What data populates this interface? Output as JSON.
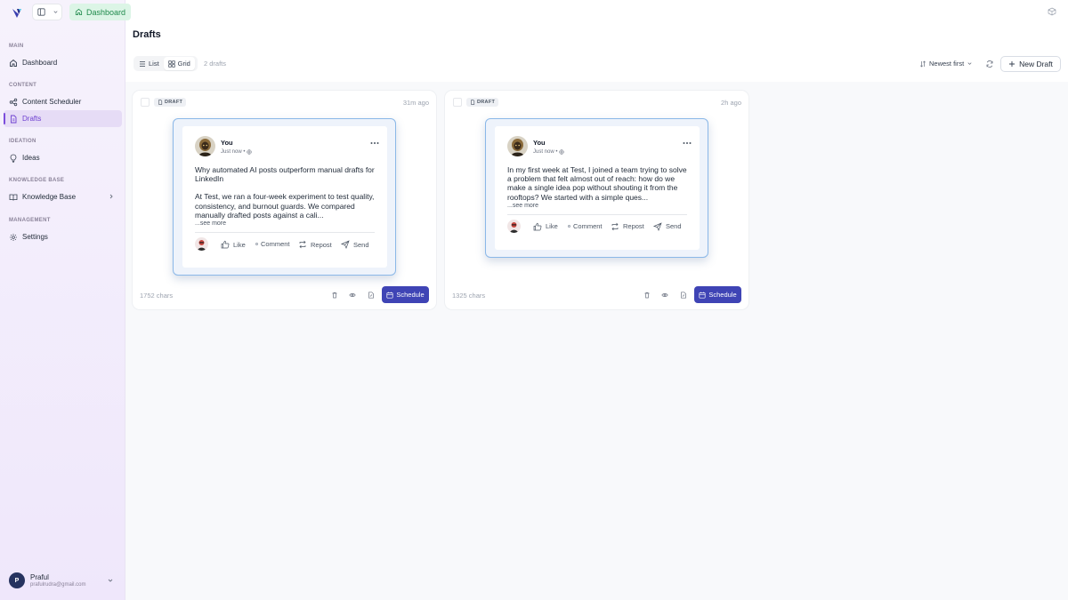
{
  "topbar": {
    "breadcrumb": "Dashboard"
  },
  "sidebar": {
    "sections": [
      {
        "label": "MAIN"
      },
      {
        "label": "CONTENT"
      },
      {
        "label": "IDEATION"
      },
      {
        "label": "KNOWLEDGE BASE"
      },
      {
        "label": "MANAGEMENT"
      }
    ],
    "items": [
      {
        "label": "Dashboard",
        "icon": "home-icon"
      },
      {
        "label": "Content Scheduler",
        "icon": "share-icon"
      },
      {
        "label": "Drafts",
        "icon": "document-icon",
        "active": true
      },
      {
        "label": "Ideas",
        "icon": "lightbulb-icon"
      },
      {
        "label": "Knowledge Base",
        "icon": "book-icon"
      },
      {
        "label": "Settings",
        "icon": "gear-icon"
      }
    ],
    "user": {
      "initial": "P",
      "name": "Praful",
      "email": "prafulrudra@gmail.com"
    }
  },
  "main": {
    "title": "Drafts",
    "view_toggle": {
      "list_label": "List",
      "grid_label": "Grid",
      "selected": "Grid"
    },
    "draft_count": "2 drafts",
    "sort_label": "Newest first",
    "new_draft_label": "New Draft"
  },
  "cards": [
    {
      "badge": "DRAFT",
      "time": "31m ago",
      "author": "You",
      "meta": "Just now •",
      "paragraphs": [
        "Why automated AI posts outperform manual drafts for LinkedIn",
        "At Test, we ran a four-week experiment to test quality, consistency, and burnout guards. We compared manually drafted posts against a cali..."
      ],
      "see_more": "...see more",
      "actions": {
        "like": "Like",
        "comment": "Comment",
        "repost": "Repost",
        "send": "Send"
      },
      "chars": "1752 chars",
      "schedule_label": "Schedule"
    },
    {
      "badge": "DRAFT",
      "time": "2h ago",
      "author": "You",
      "meta": "Just now •",
      "paragraphs": [
        "In my first week at Test, I joined a team trying to solve a problem that felt almost out of reach: how do we make a single idea pop without shouting it from the rooftops? We started with a simple ques..."
      ],
      "see_more": "...see more",
      "actions": {
        "like": "Like",
        "comment": "Comment",
        "repost": "Repost",
        "send": "Send"
      },
      "chars": "1325 chars",
      "schedule_label": "Schedule"
    }
  ],
  "colors": {
    "accent": "#7c4ddc",
    "schedule_button": "#3f44b5",
    "breadcrumb_bg": "#dcf5e6",
    "preview_border": "#8bb8e8"
  }
}
